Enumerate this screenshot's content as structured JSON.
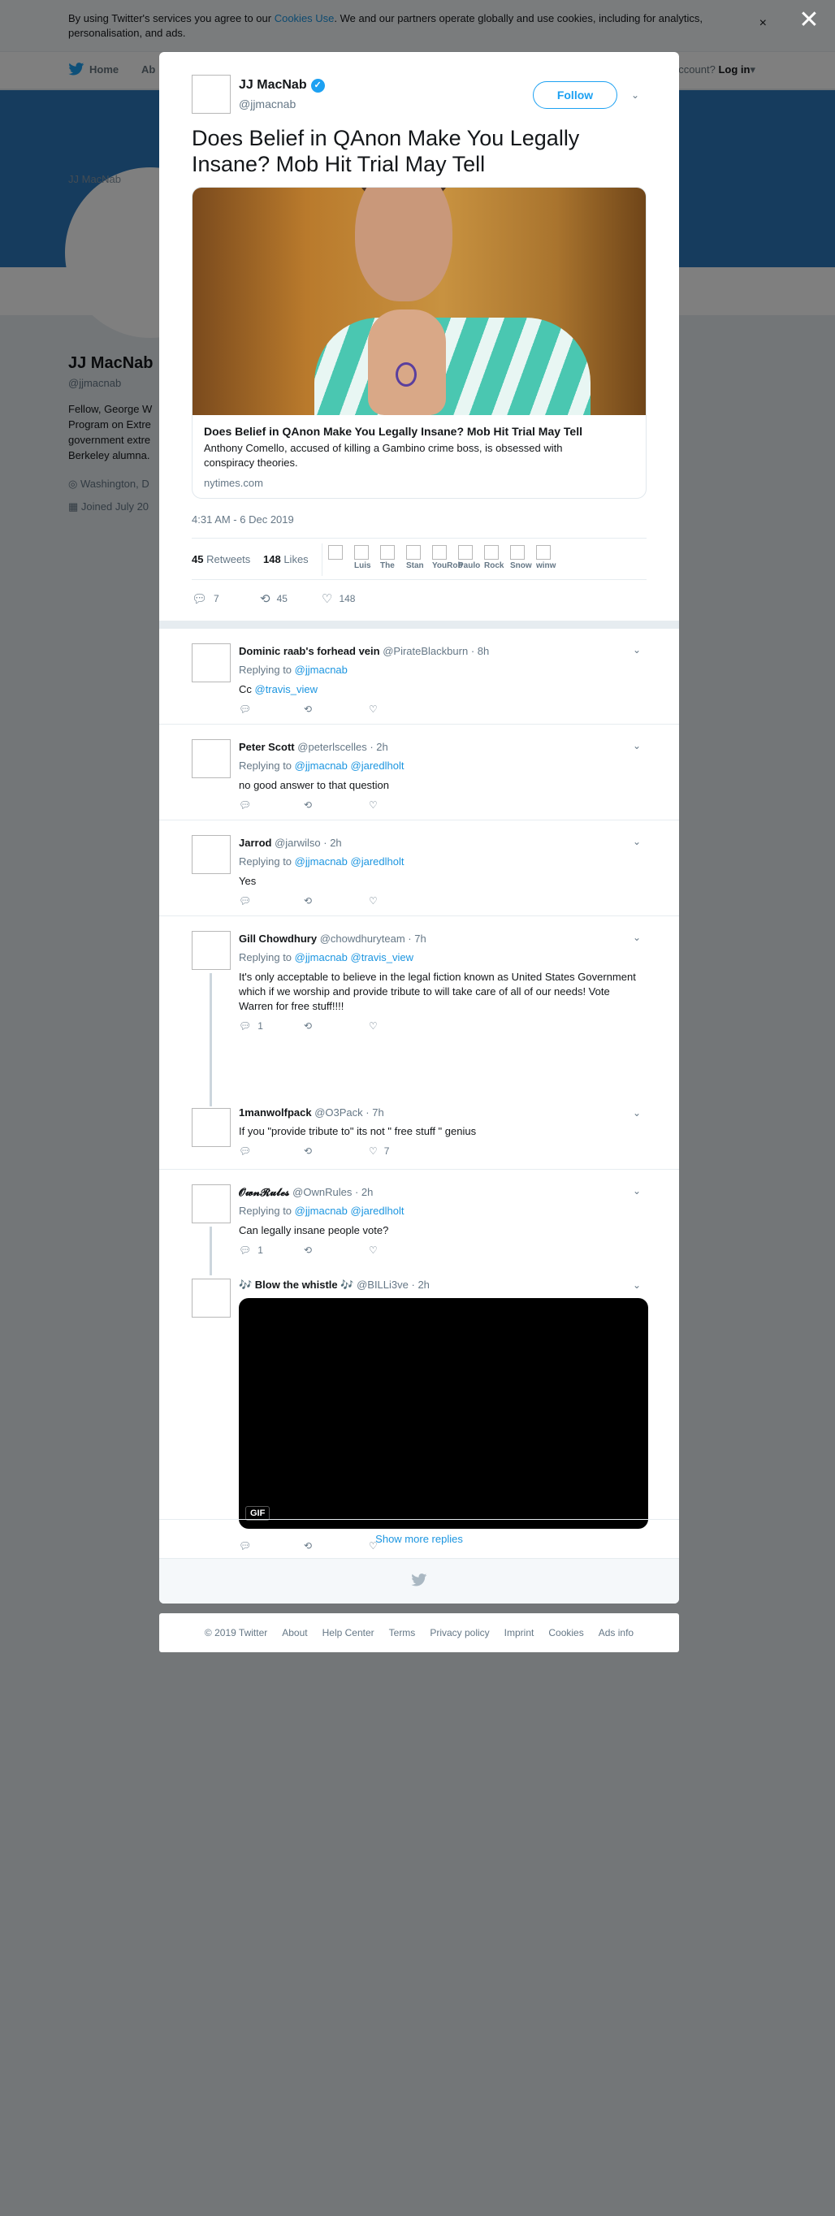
{
  "cookie_banner": {
    "text_before": "By using Twitter's services you agree to our ",
    "link": "Cookies Use",
    "text_after": ". We and our partners operate globally and use cookies, including for analytics, personalisation, and ads.",
    "close": "×"
  },
  "topnav": {
    "home": "Home",
    "about": "Ab",
    "account_text": "ccount?",
    "login": "Log in"
  },
  "profile": {
    "avatar_alt": "JJ MacNab",
    "name": "JJ MacNab",
    "handle": "@jjmacnab",
    "bio": "Fellow, George W\nProgram on Extre\ngovernment extre\nBerkeley alumna.",
    "location": "Washington, D",
    "joined": "Joined July 20"
  },
  "modal": {
    "close": "✕",
    "tweet": {
      "name": "JJ MacNab",
      "verified_icon": "✓",
      "handle": "@jjmacnab",
      "follow": "Follow",
      "text": "Does Belief in QAnon Make You Legally Insane? Mob Hit Trial May Tell",
      "card": {
        "title": "Does Belief in QAnon Make You Legally Insane? Mob Hit Trial May Tell",
        "description": "Anthony Comello, accused of killing a Gambino crime boss, is obsessed with conspiracy theories.",
        "domain": "nytimes.com"
      },
      "timestamp": "4:31 AM - 6 Dec 2019",
      "retweets_count": "45",
      "retweets_label": "Retweets",
      "likes_count": "148",
      "likes_label": "Likes",
      "likers": [
        "",
        "Luis",
        "The",
        "Stan",
        "YouRob",
        "Paulo",
        "Rock",
        "Snow",
        "winw"
      ],
      "actions": {
        "reply": "7",
        "retweet": "45",
        "like": "148"
      }
    },
    "replies": [
      {
        "name": "Dominic raab's forhead vein",
        "handle": "@PirateBlackburn",
        "time": "· 8h",
        "replying_label": "Replying to",
        "replying_to": [
          "@jjmacnab"
        ],
        "text_prefix": "Cc ",
        "text_link": "@travis_view",
        "actions": {
          "reply": "",
          "retweet": "",
          "like": ""
        }
      },
      {
        "name": "Peter Scott",
        "handle": "@peterlscelles",
        "time": "· 2h",
        "replying_label": "Replying to",
        "replying_to": [
          "@jjmacnab",
          "@jaredlholt"
        ],
        "text": "no good answer to that question",
        "actions": {
          "reply": "",
          "retweet": "",
          "like": ""
        }
      },
      {
        "name": "Jarrod",
        "handle": "@jarwilso",
        "time": "· 2h",
        "replying_label": "Replying to",
        "replying_to": [
          "@jjmacnab",
          "@jaredlholt"
        ],
        "text": "Yes",
        "actions": {
          "reply": "",
          "retweet": "",
          "like": ""
        }
      },
      {
        "name": "Gill Chowdhury",
        "handle": "@chowdhuryteam",
        "time": "· 7h",
        "replying_label": "Replying to",
        "replying_to": [
          "@jjmacnab",
          "@travis_view"
        ],
        "text": "It's only acceptable to believe in the legal fiction known as United States Government which if we worship and provide tribute to will take care of all of our needs! Vote Warren for free stuff!!!!",
        "actions": {
          "reply": "1",
          "retweet": "",
          "like": ""
        }
      },
      {
        "name": "1manwolfpack",
        "handle": "@O3Pack",
        "time": "· 7h",
        "text": "If you \"provide tribute to\"  its not \" free stuff \" genius",
        "actions": {
          "reply": "",
          "retweet": "",
          "like": "7"
        }
      },
      {
        "name": "𝓞𝔀𝓷𝓡𝓾𝓵𝓮𝓼",
        "handle": "@OwnRules",
        "time": "· 2h",
        "replying_label": "Replying to",
        "replying_to": [
          "@jjmacnab",
          "@jaredlholt"
        ],
        "text": "Can legally insane people vote?",
        "actions": {
          "reply": "1",
          "retweet": "",
          "like": ""
        }
      },
      {
        "name": "🎶 Blow the whistle 🎶",
        "handle": "@BILLi3ve",
        "time": "· 2h",
        "gif_label": "GIF",
        "actions": {
          "reply": "",
          "retweet": "",
          "like": ""
        }
      }
    ],
    "show_more": "Show more replies"
  },
  "footer": {
    "links": [
      "© 2019 Twitter",
      "About",
      "Help Center",
      "Terms",
      "Privacy policy",
      "Imprint",
      "Cookies",
      "Ads info"
    ]
  },
  "icons": {
    "reply": "reply-icon",
    "retweet": "retweet-icon",
    "like": "heart-icon",
    "caret": "chevron-down-icon",
    "twitter": "twitter-bird-icon"
  },
  "colors": {
    "accent": "#1da1f2",
    "link": "#1b95e0",
    "banner": "#2d78bd"
  }
}
